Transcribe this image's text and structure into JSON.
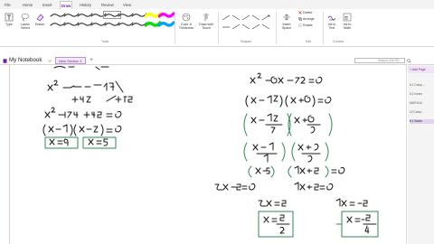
{
  "menu": {
    "tabs": [
      "File",
      "Home",
      "Insert",
      "Draw",
      "History",
      "Review",
      "View"
    ],
    "active": "Draw"
  },
  "ribbon": {
    "tools": [
      {
        "label": "Type",
        "icon": "text-cursor-icon"
      },
      {
        "label": "Lasso\nSelect",
        "icon": "lasso-icon"
      },
      {
        "label": "Eraser",
        "icon": "eraser-icon"
      }
    ],
    "pens_row1": [
      "#111111",
      "#111111",
      "#111111",
      "#111111",
      "#111111",
      "#111111",
      "#111111",
      "#ffff00",
      "#ff00ff"
    ],
    "pens_row2": [
      "#111111",
      "#111111",
      "#111111",
      "#111111",
      "#111111",
      "#111111",
      "#111111",
      "#00dd00",
      "#00a0ff"
    ],
    "tools_group_label": "Tools",
    "convert": [
      {
        "label": "Color &\nThickness",
        "icon": "palette-icon"
      },
      {
        "label": "Draw with\nTouch",
        "icon": "touch-draw-icon"
      }
    ],
    "shapes_group_label": "Shapes",
    "edit": [
      {
        "label": "Insert\nSpace",
        "icon": "insert-space-icon"
      },
      {
        "label": "Delete",
        "icon": "delete-icon"
      },
      {
        "label": "Arrange",
        "icon": "arrange-icon"
      },
      {
        "label": "Rotate",
        "icon": "rotate-icon"
      }
    ],
    "edit_group_label": "Edit",
    "convert2": [
      {
        "label": "Ink to\nText",
        "icon": "ink-to-text-icon"
      },
      {
        "label": "Ink to\nMath",
        "icon": "ink-to-math-icon"
      }
    ],
    "convert_group_label": "Convert"
  },
  "notebook": {
    "title": "My Notebook",
    "section": "New Section 1",
    "add_label": "+",
    "search_placeholder": "Search (Ctrl+E)"
  },
  "pages": {
    "add_label": "+ Add Page",
    "items": [
      "6.1 Comp...",
      "6.2 Invers",
      "MATH110",
      "10 Comp...",
      "6.1 Solvin"
    ],
    "active_index": 4
  },
  "colors": {
    "ink": "#1a1a1a",
    "circle": "#2e8b57",
    "accent": "#7719aa"
  }
}
